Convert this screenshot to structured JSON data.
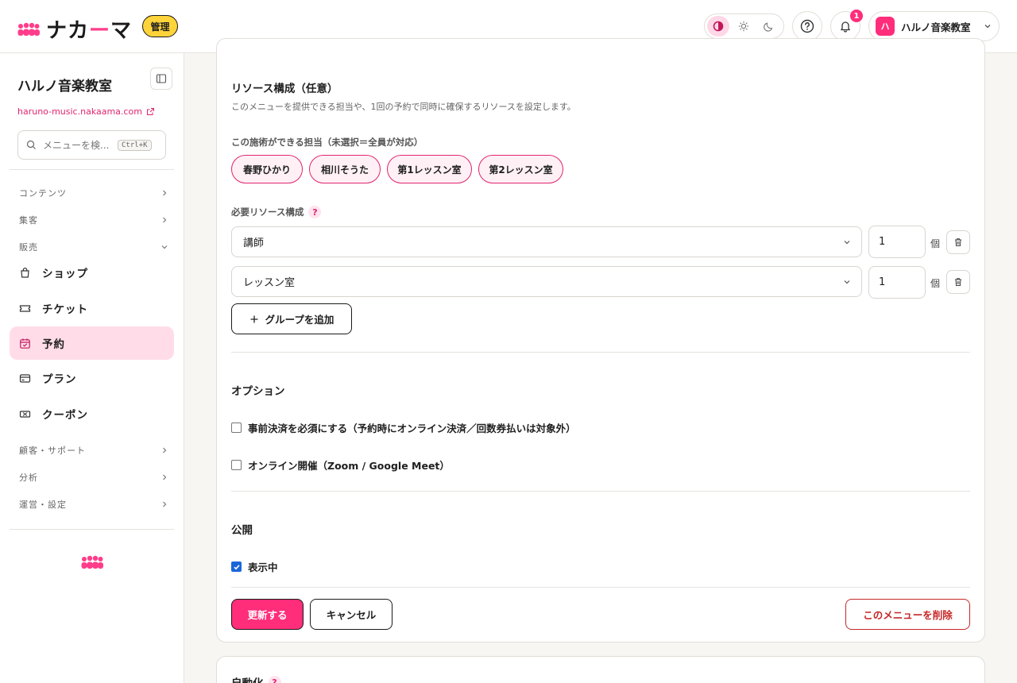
{
  "app": {
    "logo_text": "ナカーマ",
    "admin_badge": "管理"
  },
  "header": {
    "notification_count": "1",
    "account_initial": "ハ",
    "account_name": "ハルノ音楽教室"
  },
  "sidebar": {
    "title": "ハルノ音楽教室",
    "url": "haruno-music.nakaama.com",
    "search_placeholder": "メニューを検...",
    "search_shortcut": "Ctrl+K",
    "sections": [
      {
        "label": "コンテンツ"
      },
      {
        "label": "集客"
      },
      {
        "label": "販売"
      },
      {
        "label": "顧客・サポート"
      },
      {
        "label": "分析"
      },
      {
        "label": "運営・設定"
      }
    ],
    "items": [
      {
        "label": "ショップ",
        "icon": "shopping-bag-icon"
      },
      {
        "label": "チケット",
        "icon": "ticket-icon"
      },
      {
        "label": "予約",
        "icon": "calendar-check-icon"
      },
      {
        "label": "プラン",
        "icon": "credit-card-icon"
      },
      {
        "label": "クーポン",
        "icon": "coupon-icon"
      }
    ]
  },
  "resources": {
    "title": "リソース構成（任意）",
    "description": "このメニューを提供できる担当や、1回の予約で同時に確保するリソースを設定します。",
    "staff_label": "この施術ができる担当（未選択＝全員が対応）",
    "staff_chips": [
      "春野ひかり",
      "相川そうた",
      "第1レッスン室",
      "第2レッスン室"
    ],
    "required_label": "必要リソース構成",
    "help_mark": "?",
    "rows": [
      {
        "resource": "講師",
        "quantity": "1",
        "unit": "個"
      },
      {
        "resource": "レッスン室",
        "quantity": "1",
        "unit": "個"
      }
    ],
    "add_group_label": "グループを追加"
  },
  "options": {
    "title": "オプション",
    "prepay_label": "事前決済を必須にする（予約時にオンライン決済／回数券払いは対象外）",
    "prepay_checked": false,
    "online_label": "オンライン開催（Zoom / Google Meet）",
    "online_checked": false
  },
  "publish": {
    "title": "公開",
    "visible_label": "表示中",
    "visible_checked": true
  },
  "actions": {
    "update_label": "更新する",
    "cancel_label": "キャンセル",
    "delete_label": "このメニューを削除"
  },
  "next_card": {
    "title": "自動化"
  },
  "colors": {
    "accent": "#ff2d7a",
    "accent_light": "#ffdce8",
    "danger": "#c62828",
    "badge_yellow": "#ffd43b"
  }
}
